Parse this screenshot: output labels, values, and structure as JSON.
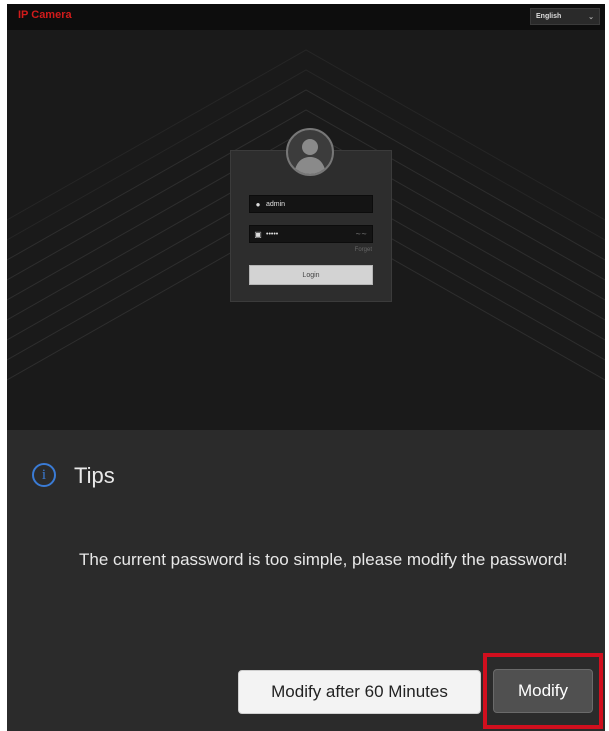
{
  "topbar": {
    "brand": "IP Camera",
    "language": "English"
  },
  "login": {
    "username": "admin",
    "password_mask": "•••••",
    "forget_label": "Forget",
    "login_label": "Login"
  },
  "tips": {
    "title": "Tips",
    "icon": "info-icon",
    "message": "The current password is too simple, please modify the password!",
    "modify_later_label": "Modify after 60 Minutes",
    "modify_label": "Modify"
  },
  "colors": {
    "brand": "#d11b1b",
    "info": "#3a7bd5",
    "highlight": "#d10f1e"
  }
}
